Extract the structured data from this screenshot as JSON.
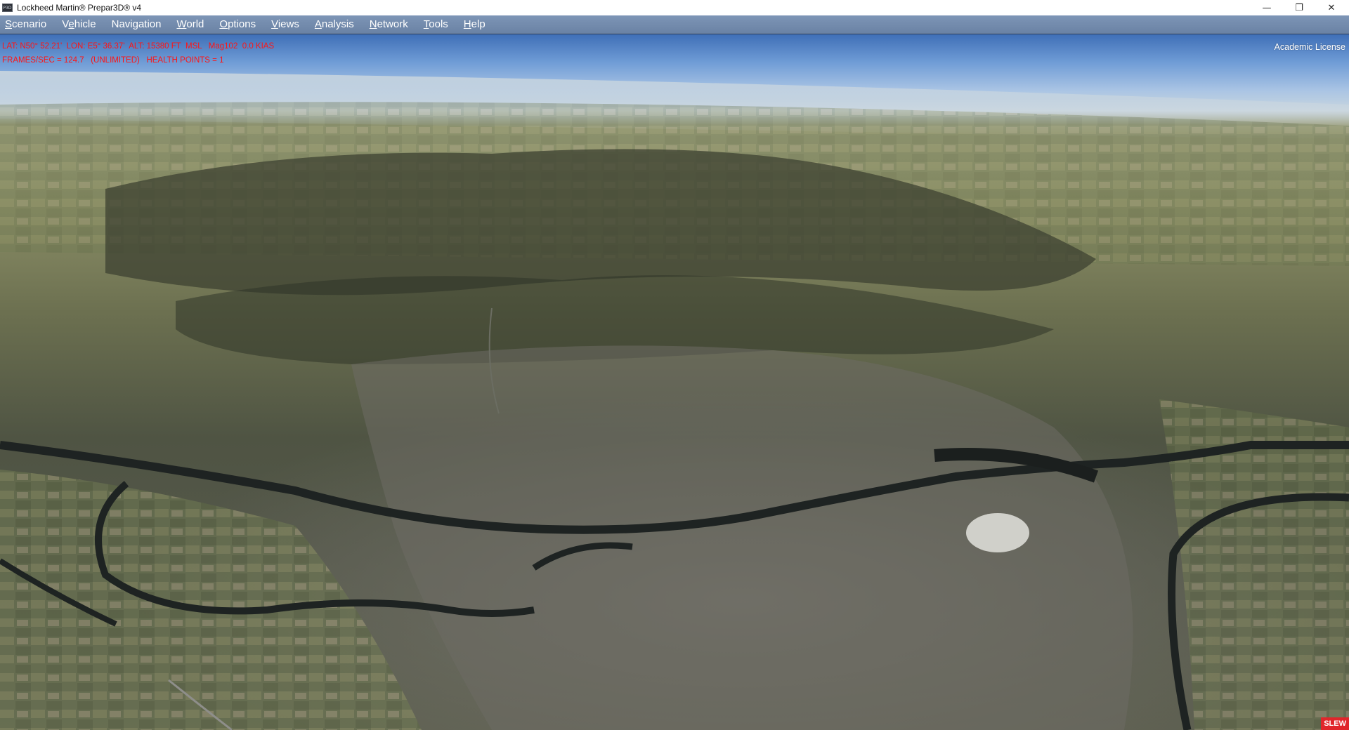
{
  "window": {
    "title": "Lockheed Martin® Prepar3D® v4",
    "app_icon_text": "P3D",
    "minimize_glyph": "—",
    "restore_glyph": "❐",
    "close_glyph": "✕"
  },
  "menu": [
    {
      "pre": "",
      "u": "S",
      "post": "cenario"
    },
    {
      "pre": "V",
      "u": "e",
      "post": "hicle"
    },
    {
      "pre": "Navi",
      "u": "g",
      "post": "ation"
    },
    {
      "pre": "",
      "u": "W",
      "post": "orld"
    },
    {
      "pre": "",
      "u": "O",
      "post": "ptions"
    },
    {
      "pre": "",
      "u": "V",
      "post": "iews"
    },
    {
      "pre": "",
      "u": "A",
      "post": "nalysis"
    },
    {
      "pre": "",
      "u": "N",
      "post": "etwork"
    },
    {
      "pre": "",
      "u": "T",
      "post": "ools"
    },
    {
      "pre": "",
      "u": "H",
      "post": "elp"
    }
  ],
  "hud": {
    "line1": "LAT: N50° 52.21'  LON: E5° 36.37'  ALT: 15380 FT  MSL   Mag102  0.0 KIAS",
    "line2": "FRAMES/SEC = 124.7   (UNLIMITED)   HEALTH POINTS = 1",
    "color": "#ff1414"
  },
  "license_text": "Academic License",
  "slew_badge": "SLEW"
}
